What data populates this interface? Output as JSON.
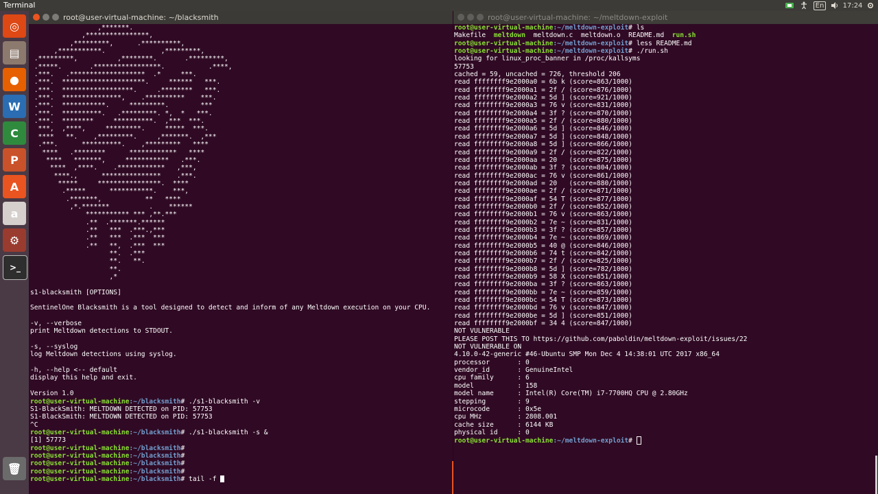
{
  "topbar": {
    "app_name": "Terminal",
    "keyboard": "En",
    "time": "17:24"
  },
  "launcher": {
    "items": [
      {
        "name": "ubuntu-dash-icon",
        "glyph": "◎",
        "color": "#dd4814"
      },
      {
        "name": "files-icon",
        "glyph": "▤",
        "color": "#8d7a6e"
      },
      {
        "name": "firefox-icon",
        "glyph": "●",
        "color": "#e66000"
      },
      {
        "name": "writer-icon",
        "glyph": "W",
        "color": "#2a6db2"
      },
      {
        "name": "calc-icon",
        "glyph": "C",
        "color": "#2f8a3e"
      },
      {
        "name": "impress-icon",
        "glyph": "P",
        "color": "#c9522a"
      },
      {
        "name": "software-center-icon",
        "glyph": "A",
        "color": "#e95420"
      },
      {
        "name": "amazon-icon",
        "glyph": "a",
        "color": "#d5d0cc"
      },
      {
        "name": "settings-icon",
        "glyph": "⚙",
        "color": "#9a3b2f"
      },
      {
        "name": "terminal-icon",
        "glyph": ">_",
        "color": "#2e2e2e"
      },
      {
        "name": "trash-icon",
        "glyph": "🗑",
        "color": "#6b6b6b"
      }
    ]
  },
  "left_window": {
    "title": "root@user-virtual-machine: ~/blacksmith",
    "lines": [
      {
        "text": "                 ,*******."
      },
      {
        "text": "             ,****************,"
      },
      {
        "text": "          ,*********,      .**********,"
      },
      {
        "text": "      ,***********.              ,*********,"
      },
      {
        "text": " .*********,          ,********.       .*********,"
      },
      {
        "text": " .*****.       .*****************.           .****,"
      },
      {
        "text": " .***.   .*******************  .*     ***."
      },
      {
        "text": " .***.  *********************.     ******   ***."
      },
      {
        "text": " .***.  ******************.     .********   ***."
      },
      {
        "text": " .***.  ***************,    .**********    ***."
      },
      {
        "text": " .***.  ***********.     *********.        ***"
      },
      {
        "text": " .***.  **********.   .*********. *,  *   ***."
      },
      {
        "text": " .***.  ********     **********.  ,***  ***."
      },
      {
        "text": "  ***,  ,****,     *********.     *****  ***."
      },
      {
        "text": "  ****   **.    ,*********.     ,*******.  ,***"
      },
      {
        "text": "  .***.      **********.    ,*********   ****"
      },
      {
        "text": "   ****   .********      ************   ****"
      },
      {
        "text": "    ****   *******,     ***********   .***."
      },
      {
        "text": "     ****  ,****.    .************   ,***,"
      },
      {
        "text": "      ****.,      ***************    .***."
      },
      {
        "text": "       *****     ****************.  ****"
      },
      {
        "text": "        .*****      ***********.    ***,"
      },
      {
        "text": "         .*******,           **   ****"
      },
      {
        "text": "          ,*.*******          .    ******"
      },
      {
        "text": "              *********** *** ,**.***"
      },
      {
        "text": "              .**  .*******.******"
      },
      {
        "text": "              .**   ***  .***.,***"
      },
      {
        "text": "              .**   ***  .***  ***"
      },
      {
        "text": "              .**   **,  .***  ***"
      },
      {
        "text": "                    **.  .***"
      },
      {
        "text": "                    **.   **."
      },
      {
        "text": "                    **."
      },
      {
        "text": "                    ,*"
      },
      {
        "text": ""
      },
      {
        "text": "s1-blacksmith [OPTIONS]"
      },
      {
        "text": ""
      },
      {
        "text": "SentinelOne Blacksmith is a tool designed to detect and inform of any Meltdown execution on your CPU."
      },
      {
        "text": ""
      },
      {
        "text": "-v, --verbose"
      },
      {
        "text": "print Meltdown detections to STDOUT."
      },
      {
        "text": ""
      },
      {
        "text": "-s, --syslog"
      },
      {
        "text": "log Meltdown detections using syslog."
      },
      {
        "text": ""
      },
      {
        "text": "-h, --help <-- default"
      },
      {
        "text": "display this help and exit."
      },
      {
        "text": ""
      },
      {
        "text": "Version 1.0"
      },
      {
        "prompt": "root@user-virtual-machine",
        "path": ":~/blacksmith",
        "cmd": "# ./s1-blacksmith -v"
      },
      {
        "text": "S1-BlackSmith: MELTDOWN DETECTED on PID: 57753"
      },
      {
        "text": "S1-BlackSmith: MELTDOWN DETECTED on PID: 57753"
      },
      {
        "text": "^C"
      },
      {
        "prompt": "root@user-virtual-machine",
        "path": ":~/blacksmith",
        "cmd": "# ./s1-blacksmith -s &"
      },
      {
        "text": "[1] 57773"
      },
      {
        "prompt": "root@user-virtual-machine",
        "path": ":~/blacksmith",
        "cmd": "#"
      },
      {
        "prompt": "root@user-virtual-machine",
        "path": ":~/blacksmith",
        "cmd": "#"
      },
      {
        "prompt": "root@user-virtual-machine",
        "path": ":~/blacksmith",
        "cmd": "#"
      },
      {
        "prompt": "root@user-virtual-machine",
        "path": ":~/blacksmith",
        "cmd": "#"
      },
      {
        "prompt": "root@user-virtual-machine",
        "path": ":~/blacksmith",
        "cmd": "# tail -f ",
        "cursor": "solid"
      }
    ]
  },
  "right_window": {
    "title": "root@user-virtual-machine: ~/meltdown-exploit",
    "lines": [
      {
        "prompt": "root@user-virtual-machine",
        "path": ":~/meltdown-exploit",
        "cmd": "# ls"
      },
      {
        "segments": [
          {
            "text": "Makefile  ",
            "style": ""
          },
          {
            "text": "meltdown",
            "style": "green"
          },
          {
            "text": "  meltdown.c  meltdown.o  README.md  ",
            "style": ""
          },
          {
            "text": "run.sh",
            "style": "green"
          }
        ]
      },
      {
        "prompt": "root@user-virtual-machine",
        "path": ":~/meltdown-exploit",
        "cmd": "# less README.md"
      },
      {
        "prompt": "root@user-virtual-machine",
        "path": ":~/meltdown-exploit",
        "cmd": "# ./run.sh"
      },
      {
        "text": "looking for linux_proc_banner in /proc/kallsyms"
      },
      {
        "text": "57753"
      },
      {
        "text": "cached = 59, uncached = 726, threshold 206"
      },
      {
        "text": "read ffffffff9e2000a0 = 6b k (score=863/1000)"
      },
      {
        "text": "read ffffffff9e2000a1 = 2f / (score=876/1000)"
      },
      {
        "text": "read ffffffff9e2000a2 = 5d ] (score=921/1000)"
      },
      {
        "text": "read ffffffff9e2000a3 = 76 v (score=831/1000)"
      },
      {
        "text": "read ffffffff9e2000a4 = 3f ? (score=870/1000)"
      },
      {
        "text": "read ffffffff9e2000a5 = 2f / (score=880/1000)"
      },
      {
        "text": "read ffffffff9e2000a6 = 5d ] (score=846/1000)"
      },
      {
        "text": "read ffffffff9e2000a7 = 5d ] (score=848/1000)"
      },
      {
        "text": "read ffffffff9e2000a8 = 5d ] (score=866/1000)"
      },
      {
        "text": "read ffffffff9e2000a9 = 2f / (score=822/1000)"
      },
      {
        "text": "read ffffffff9e2000aa = 20   (score=875/1000)"
      },
      {
        "text": "read ffffffff9e2000ab = 3f ? (score=804/1000)"
      },
      {
        "text": "read ffffffff9e2000ac = 76 v (score=861/1000)"
      },
      {
        "text": "read ffffffff9e2000ad = 20   (score=880/1000)"
      },
      {
        "text": "read ffffffff9e2000ae = 2f / (score=871/1000)"
      },
      {
        "text": "read ffffffff9e2000af = 54 T (score=877/1000)"
      },
      {
        "text": "read ffffffff9e2000b0 = 2f / (score=852/1000)"
      },
      {
        "text": "read ffffffff9e2000b1 = 76 v (score=863/1000)"
      },
      {
        "text": "read ffffffff9e2000b2 = 7e ~ (score=831/1000)"
      },
      {
        "text": "read ffffffff9e2000b3 = 3f ? (score=857/1000)"
      },
      {
        "text": "read ffffffff9e2000b4 = 7e ~ (score=869/1000)"
      },
      {
        "text": "read ffffffff9e2000b5 = 40 @ (score=846/1000)"
      },
      {
        "text": "read ffffffff9e2000b6 = 74 t (score=842/1000)"
      },
      {
        "text": "read ffffffff9e2000b7 = 2f / (score=825/1000)"
      },
      {
        "text": "read ffffffff9e2000b8 = 5d ] (score=782/1000)"
      },
      {
        "text": "read ffffffff9e2000b9 = 58 X (score=851/1000)"
      },
      {
        "text": "read ffffffff9e2000ba = 3f ? (score=863/1000)"
      },
      {
        "text": "read ffffffff9e2000bb = 7e ~ (score=859/1000)"
      },
      {
        "text": "read ffffffff9e2000bc = 54 T (score=873/1000)"
      },
      {
        "text": "read ffffffff9e2000bd = 76 v (score=847/1000)"
      },
      {
        "text": "read ffffffff9e2000be = 5d ] (score=851/1000)"
      },
      {
        "text": "read ffffffff9e2000bf = 34 4 (score=847/1000)"
      },
      {
        "text": "NOT VULNERABLE"
      },
      {
        "text": "PLEASE POST THIS TO https://github.com/paboldin/meltdown-exploit/issues/22"
      },
      {
        "text": "NOT VULNERABLE ON"
      },
      {
        "text": "4.10.0-42-generic #46-Ubuntu SMP Mon Dec 4 14:38:01 UTC 2017 x86_64"
      },
      {
        "text": "processor       : 0"
      },
      {
        "text": "vendor_id       : GenuineIntel"
      },
      {
        "text": "cpu family      : 6"
      },
      {
        "text": "model           : 158"
      },
      {
        "text": "model name      : Intel(R) Core(TM) i7-7700HQ CPU @ 2.80GHz"
      },
      {
        "text": "stepping        : 9"
      },
      {
        "text": "microcode       : 0x5e"
      },
      {
        "text": "cpu MHz         : 2808.001"
      },
      {
        "text": "cache size      : 6144 KB"
      },
      {
        "text": "physical id     : 0"
      },
      {
        "prompt": "root@user-virtual-machine",
        "path": ":~/meltdown-exploit",
        "cmd": "# ",
        "cursor": "outline"
      }
    ]
  }
}
